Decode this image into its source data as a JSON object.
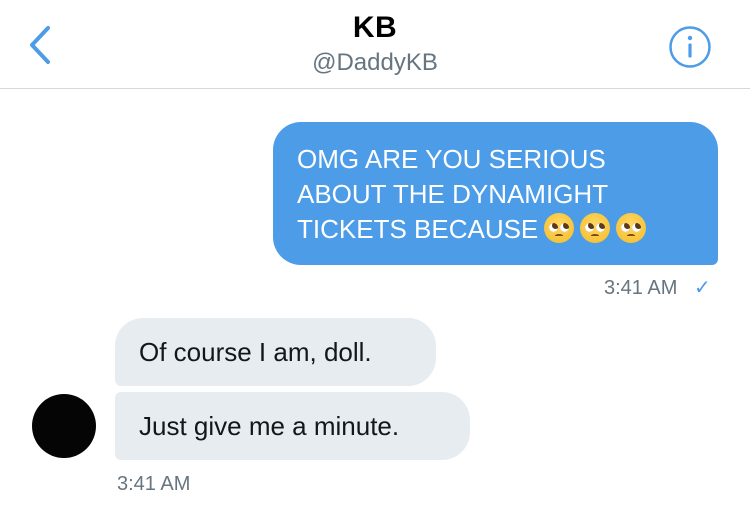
{
  "header": {
    "back_icon": "chevron-left-icon",
    "title": "KB",
    "handle": "@DaddyKB",
    "info_icon": "info-icon"
  },
  "messages": {
    "outgoing": {
      "text": "OMG ARE YOU SERIOUS\nABOUT THE DYNAMIGHT\nTICKETS BECAUSE",
      "emojis": [
        "pleading-face-emoji",
        "pleading-face-emoji",
        "pleading-face-emoji"
      ],
      "time": "3:41 AM",
      "status": "✓"
    },
    "incoming": [
      {
        "text": "Of course I am, doll."
      },
      {
        "text": "Just give me a minute."
      }
    ],
    "incoming_time": "3:41 AM"
  },
  "colors": {
    "accent": "#4c9ce8",
    "incoming_bubble": "#e6ecf0",
    "secondary_text": "#66757f"
  }
}
